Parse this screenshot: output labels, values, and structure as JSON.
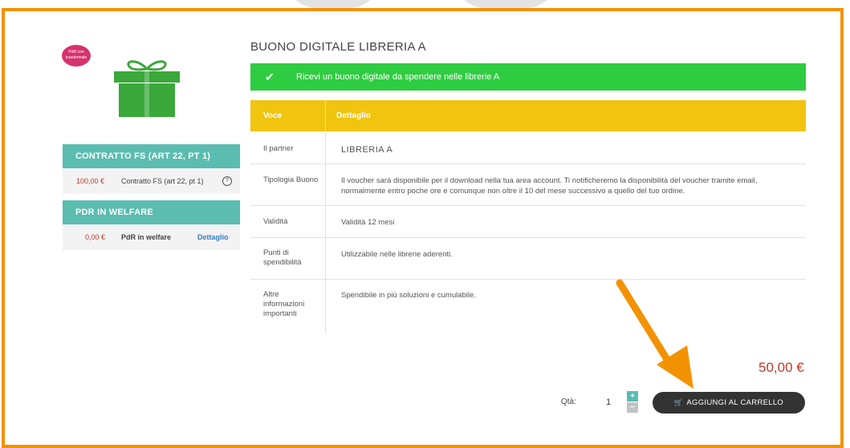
{
  "badge": {
    "text": "PdR con trasdormale"
  },
  "sidebar": {
    "section1": {
      "title": "CONTRATTO FS (ART 22, PT 1)",
      "amount": "100,00 €",
      "label": "Contratto FS (art 22, pt 1)"
    },
    "section2": {
      "title": "PDR IN WELFARE",
      "amount": "0,00 €",
      "label": "PdR in welfare",
      "link": "Dettaglio"
    }
  },
  "product": {
    "title": "BUONO DIGITALE LIBRERIA A",
    "banner": "Ricevi un buono digitale da spendere nelle librerie A"
  },
  "table": {
    "headers": {
      "voce": "Voce",
      "dettaglio": "Dettaglio"
    },
    "rows": [
      {
        "voce": "Il partner",
        "dettaglio": "LIBRERIA A"
      },
      {
        "voce": "Tipologia Buono",
        "dettaglio": "Il voucher sarà disponibile per il download nella tua area account. Ti notificheremo la disponibilità del voucher tramite email, normalmente entro poche ore e comunque non oltre il 10 del mese successivo a quello del tuo ordine."
      },
      {
        "voce": "Validità",
        "dettaglio": "Validità 12 mesi"
      },
      {
        "voce": "Punti di spendibilità",
        "dettaglio": "Utilizzabile nelle librerie aderenti."
      },
      {
        "voce": "Altre informazioni importanti",
        "dettaglio": "Spendibile in più soluzioni e cumulabile."
      }
    ]
  },
  "purchase": {
    "price": "50,00 €",
    "qty_label": "Qtà:",
    "qty_value": "1",
    "plus": "+",
    "minus": "−",
    "cart_button": "AGGIUNGI AL CARRELLO"
  },
  "colors": {
    "frame": "#f39200",
    "teal": "#5bbcb0",
    "green": "#2ecc40",
    "yellow": "#f1c40f",
    "price_red": "#c0392b",
    "button_dark": "#333333"
  },
  "icons": {
    "gift": "gift-icon",
    "check": "check-icon",
    "info": "info-icon",
    "cart": "cart-icon",
    "arrow": "annotation-arrow"
  }
}
